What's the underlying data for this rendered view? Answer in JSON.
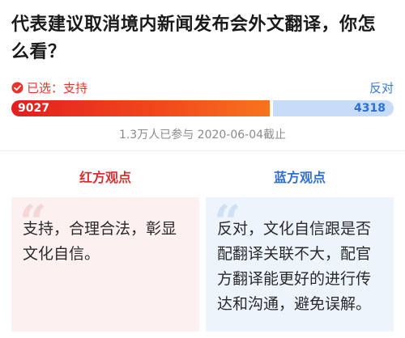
{
  "question": "代表建议取消境内新闻发布会外文翻译，你怎么看？",
  "vote": {
    "chosen_label": "已选：支持",
    "against_label": "反对",
    "support_count": "9027",
    "oppose_count": "4318",
    "support_fraction": 0.676,
    "colors": {
      "support": "#e8332c",
      "oppose": "#c7dcf6"
    }
  },
  "meta": "1.3万人已参与 2020-06-04截止",
  "sides": {
    "red": {
      "title": "红方观点",
      "text": "支持，合理合法，彰显文化自信。"
    },
    "blue": {
      "title": "蓝方观点",
      "text": "反对，文化自信跟是否配翻译关联不大，配官方翻译能更好的进行传达和沟通，避免误解。"
    }
  }
}
